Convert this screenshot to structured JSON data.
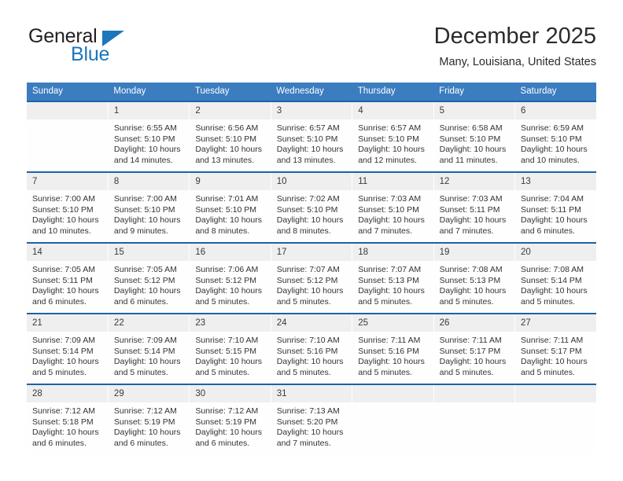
{
  "brand": {
    "name_part1": "General",
    "name_part2": "Blue",
    "logo_icon": "triangle-icon"
  },
  "header": {
    "title": "December 2025",
    "subtitle": "Many, Louisiana, United States"
  },
  "calendar": {
    "weekday_headers": [
      "Sunday",
      "Monday",
      "Tuesday",
      "Wednesday",
      "Thursday",
      "Friday",
      "Saturday"
    ],
    "accent_header_color": "#3b7dbf",
    "row_border_color": "#1b63a8",
    "daynum_band_color": "#efefef",
    "weeks": [
      [
        {
          "day": "",
          "lines": []
        },
        {
          "day": "1",
          "lines": [
            "Sunrise: 6:55 AM",
            "Sunset: 5:10 PM",
            "Daylight: 10 hours",
            "and 14 minutes."
          ]
        },
        {
          "day": "2",
          "lines": [
            "Sunrise: 6:56 AM",
            "Sunset: 5:10 PM",
            "Daylight: 10 hours",
            "and 13 minutes."
          ]
        },
        {
          "day": "3",
          "lines": [
            "Sunrise: 6:57 AM",
            "Sunset: 5:10 PM",
            "Daylight: 10 hours",
            "and 13 minutes."
          ]
        },
        {
          "day": "4",
          "lines": [
            "Sunrise: 6:57 AM",
            "Sunset: 5:10 PM",
            "Daylight: 10 hours",
            "and 12 minutes."
          ]
        },
        {
          "day": "5",
          "lines": [
            "Sunrise: 6:58 AM",
            "Sunset: 5:10 PM",
            "Daylight: 10 hours",
            "and 11 minutes."
          ]
        },
        {
          "day": "6",
          "lines": [
            "Sunrise: 6:59 AM",
            "Sunset: 5:10 PM",
            "Daylight: 10 hours",
            "and 10 minutes."
          ]
        }
      ],
      [
        {
          "day": "7",
          "lines": [
            "Sunrise: 7:00 AM",
            "Sunset: 5:10 PM",
            "Daylight: 10 hours",
            "and 10 minutes."
          ]
        },
        {
          "day": "8",
          "lines": [
            "Sunrise: 7:00 AM",
            "Sunset: 5:10 PM",
            "Daylight: 10 hours",
            "and 9 minutes."
          ]
        },
        {
          "day": "9",
          "lines": [
            "Sunrise: 7:01 AM",
            "Sunset: 5:10 PM",
            "Daylight: 10 hours",
            "and 8 minutes."
          ]
        },
        {
          "day": "10",
          "lines": [
            "Sunrise: 7:02 AM",
            "Sunset: 5:10 PM",
            "Daylight: 10 hours",
            "and 8 minutes."
          ]
        },
        {
          "day": "11",
          "lines": [
            "Sunrise: 7:03 AM",
            "Sunset: 5:10 PM",
            "Daylight: 10 hours",
            "and 7 minutes."
          ]
        },
        {
          "day": "12",
          "lines": [
            "Sunrise: 7:03 AM",
            "Sunset: 5:11 PM",
            "Daylight: 10 hours",
            "and 7 minutes."
          ]
        },
        {
          "day": "13",
          "lines": [
            "Sunrise: 7:04 AM",
            "Sunset: 5:11 PM",
            "Daylight: 10 hours",
            "and 6 minutes."
          ]
        }
      ],
      [
        {
          "day": "14",
          "lines": [
            "Sunrise: 7:05 AM",
            "Sunset: 5:11 PM",
            "Daylight: 10 hours",
            "and 6 minutes."
          ]
        },
        {
          "day": "15",
          "lines": [
            "Sunrise: 7:05 AM",
            "Sunset: 5:12 PM",
            "Daylight: 10 hours",
            "and 6 minutes."
          ]
        },
        {
          "day": "16",
          "lines": [
            "Sunrise: 7:06 AM",
            "Sunset: 5:12 PM",
            "Daylight: 10 hours",
            "and 5 minutes."
          ]
        },
        {
          "day": "17",
          "lines": [
            "Sunrise: 7:07 AM",
            "Sunset: 5:12 PM",
            "Daylight: 10 hours",
            "and 5 minutes."
          ]
        },
        {
          "day": "18",
          "lines": [
            "Sunrise: 7:07 AM",
            "Sunset: 5:13 PM",
            "Daylight: 10 hours",
            "and 5 minutes."
          ]
        },
        {
          "day": "19",
          "lines": [
            "Sunrise: 7:08 AM",
            "Sunset: 5:13 PM",
            "Daylight: 10 hours",
            "and 5 minutes."
          ]
        },
        {
          "day": "20",
          "lines": [
            "Sunrise: 7:08 AM",
            "Sunset: 5:14 PM",
            "Daylight: 10 hours",
            "and 5 minutes."
          ]
        }
      ],
      [
        {
          "day": "21",
          "lines": [
            "Sunrise: 7:09 AM",
            "Sunset: 5:14 PM",
            "Daylight: 10 hours",
            "and 5 minutes."
          ]
        },
        {
          "day": "22",
          "lines": [
            "Sunrise: 7:09 AM",
            "Sunset: 5:14 PM",
            "Daylight: 10 hours",
            "and 5 minutes."
          ]
        },
        {
          "day": "23",
          "lines": [
            "Sunrise: 7:10 AM",
            "Sunset: 5:15 PM",
            "Daylight: 10 hours",
            "and 5 minutes."
          ]
        },
        {
          "day": "24",
          "lines": [
            "Sunrise: 7:10 AM",
            "Sunset: 5:16 PM",
            "Daylight: 10 hours",
            "and 5 minutes."
          ]
        },
        {
          "day": "25",
          "lines": [
            "Sunrise: 7:11 AM",
            "Sunset: 5:16 PM",
            "Daylight: 10 hours",
            "and 5 minutes."
          ]
        },
        {
          "day": "26",
          "lines": [
            "Sunrise: 7:11 AM",
            "Sunset: 5:17 PM",
            "Daylight: 10 hours",
            "and 5 minutes."
          ]
        },
        {
          "day": "27",
          "lines": [
            "Sunrise: 7:11 AM",
            "Sunset: 5:17 PM",
            "Daylight: 10 hours",
            "and 5 minutes."
          ]
        }
      ],
      [
        {
          "day": "28",
          "lines": [
            "Sunrise: 7:12 AM",
            "Sunset: 5:18 PM",
            "Daylight: 10 hours",
            "and 6 minutes."
          ]
        },
        {
          "day": "29",
          "lines": [
            "Sunrise: 7:12 AM",
            "Sunset: 5:19 PM",
            "Daylight: 10 hours",
            "and 6 minutes."
          ]
        },
        {
          "day": "30",
          "lines": [
            "Sunrise: 7:12 AM",
            "Sunset: 5:19 PM",
            "Daylight: 10 hours",
            "and 6 minutes."
          ]
        },
        {
          "day": "31",
          "lines": [
            "Sunrise: 7:13 AM",
            "Sunset: 5:20 PM",
            "Daylight: 10 hours",
            "and 7 minutes."
          ]
        },
        {
          "day": "",
          "lines": []
        },
        {
          "day": "",
          "lines": []
        },
        {
          "day": "",
          "lines": []
        }
      ]
    ]
  }
}
